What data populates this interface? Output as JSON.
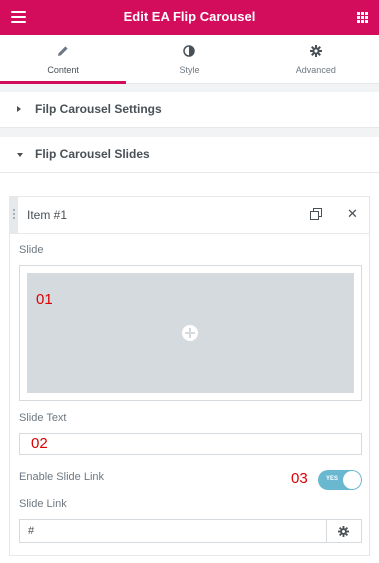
{
  "header": {
    "title": "Edit EA Flip Carousel"
  },
  "tabs": [
    {
      "label": "Content",
      "icon": "pencil-icon"
    },
    {
      "label": "Style",
      "icon": "half-circle-icon"
    },
    {
      "label": "Advanced",
      "icon": "gear-icon"
    }
  ],
  "sections": {
    "settings": "Filp Carousel Settings",
    "slides": "Flip Carousel Slides"
  },
  "item": {
    "title": "Item #1",
    "slide_label": "Slide",
    "slide_marker": "01",
    "slide_text_label": "Slide Text",
    "slide_text_marker": "02",
    "enable_link_label": "Enable Slide Link",
    "enable_link_marker": "03",
    "toggle_text": "YES",
    "slide_link_label": "Slide Link",
    "slide_link_value": "#"
  },
  "colors": {
    "accent": "#d30c5c",
    "toggle": "#6ab7d0",
    "marker": "#dd0000"
  }
}
